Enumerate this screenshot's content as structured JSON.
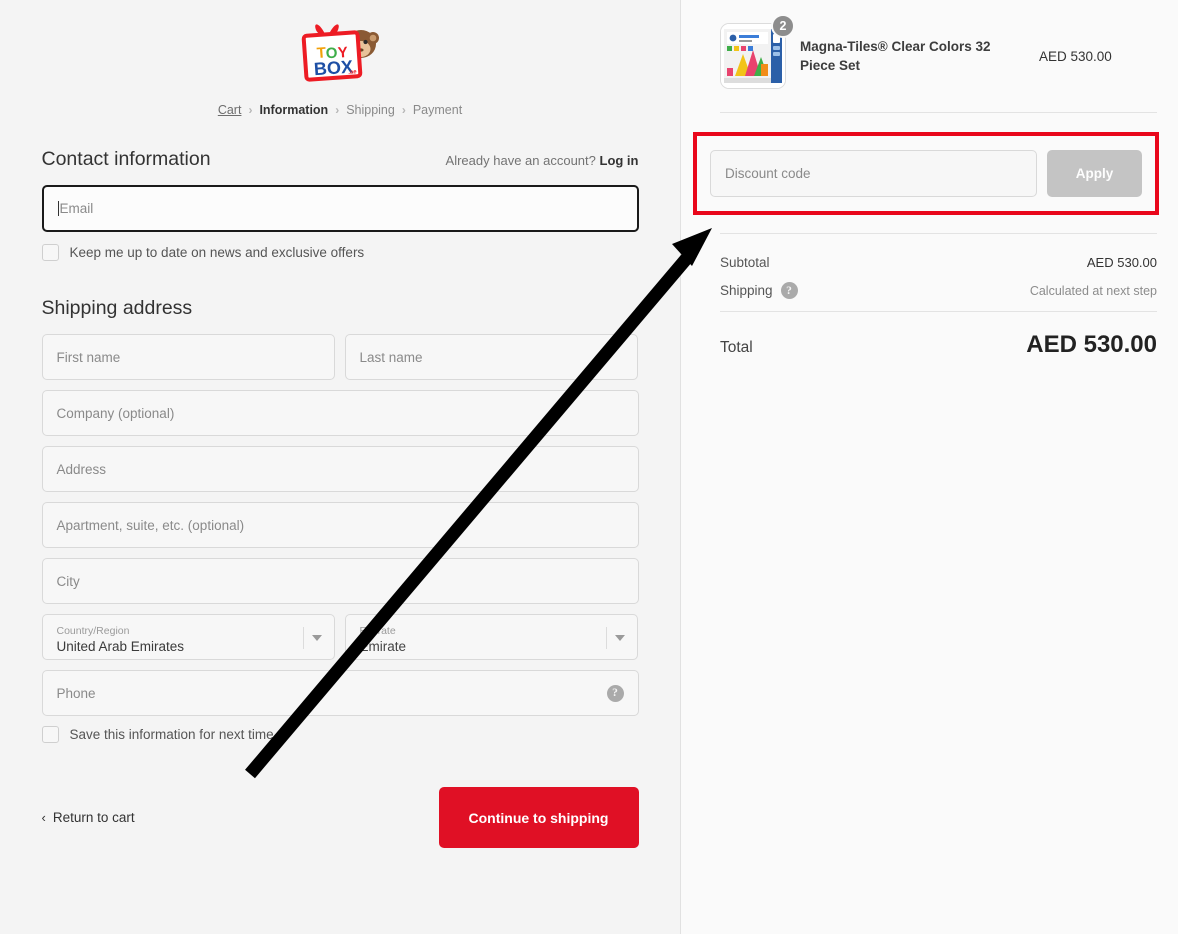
{
  "brand": {
    "logo_name": "toy-box-logo",
    "logo_text_top": "TOY",
    "logo_text_bottom": "BOX"
  },
  "breadcrumb": {
    "items": [
      {
        "label": "Cart",
        "state": "done"
      },
      {
        "label": "Information",
        "state": "current"
      },
      {
        "label": "Shipping",
        "state": "upcoming"
      },
      {
        "label": "Payment",
        "state": "upcoming"
      }
    ],
    "separator": "›"
  },
  "contact": {
    "title": "Contact information",
    "account_prompt": "Already have an account?",
    "login_label": "Log in",
    "email_placeholder": "Email",
    "email_value": "",
    "newsletter_label": "Keep me up to date on news and exclusive offers",
    "newsletter_checked": false
  },
  "shipping_address": {
    "title": "Shipping address",
    "first_name_placeholder": "First name",
    "last_name_placeholder": "Last name",
    "company_placeholder": "Company (optional)",
    "address_placeholder": "Address",
    "apartment_placeholder": "Apartment, suite, etc. (optional)",
    "city_placeholder": "City",
    "country_label": "Country/Region",
    "country_value": "United Arab Emirates",
    "emirate_label": "Emirate",
    "emirate_value": "Emirate",
    "phone_placeholder": "Phone",
    "phone_help_glyph": "?",
    "save_info_label": "Save this information for next time",
    "save_info_checked": false
  },
  "footer_actions": {
    "return_chevron": "‹",
    "return_label": "Return to cart",
    "continue_label": "Continue to shipping",
    "continue_color": "#e01025"
  },
  "order_summary": {
    "item": {
      "title": "Magna-Tiles® Clear Colors 32 Piece Set",
      "quantity": "2",
      "price": "AED 530.00"
    },
    "discount": {
      "placeholder": "Discount code",
      "value": "",
      "apply_label": "Apply",
      "highlight_color": "#e9071b"
    },
    "subtotal_label": "Subtotal",
    "subtotal_value": "AED 530.00",
    "shipping_label": "Shipping",
    "shipping_help_glyph": "?",
    "shipping_value": "Calculated at next step",
    "total_label": "Total",
    "total_value": "AED 530.00"
  },
  "annotation": {
    "arrow_name": "pointer-arrow",
    "arrow_color": "#000000",
    "arrow_from": "248,776",
    "arrow_to": "712,228"
  }
}
